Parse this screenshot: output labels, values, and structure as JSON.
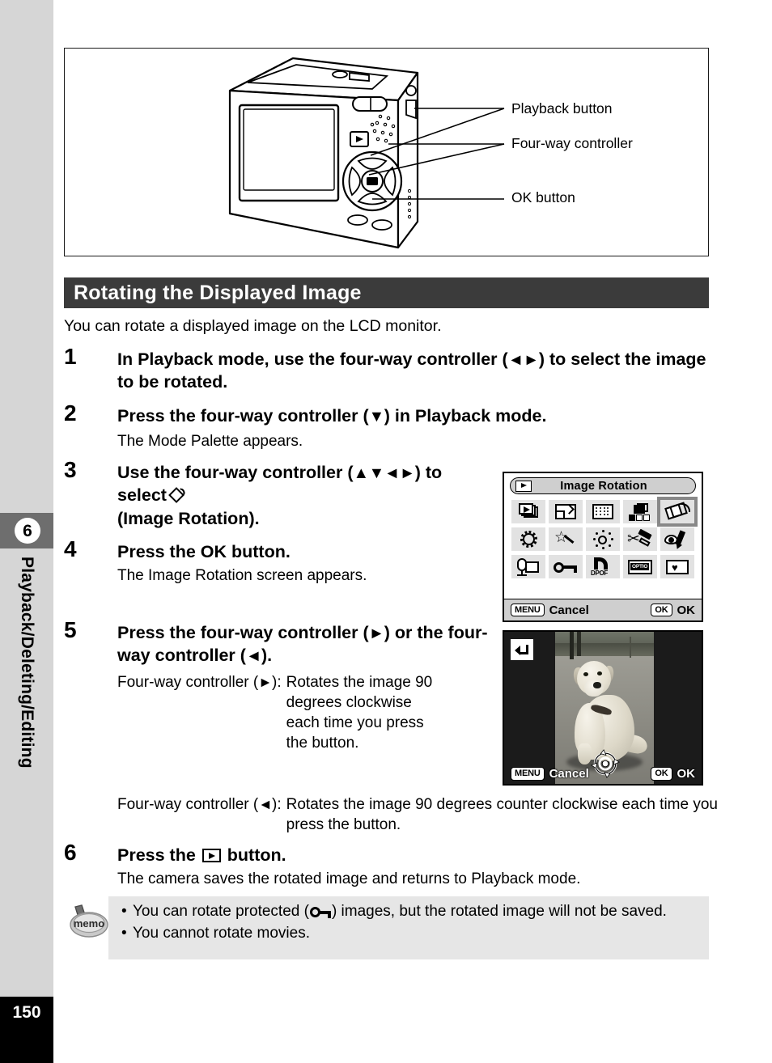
{
  "sidebar": {
    "chapter_number": "6",
    "chapter_label": "Playback/Deleting/Editing",
    "page_number": "150"
  },
  "figure": {
    "callouts": [
      {
        "label": "Playback button"
      },
      {
        "label": "Four-way controller"
      },
      {
        "label": "OK button"
      }
    ],
    "camera_parts": {
      "lcd_monitor": "lcd-monitor",
      "playback_button": "playback-button",
      "four_way_controller": "four-way-controller",
      "ok_button": "ok-button",
      "shutter_button": "shutter-button",
      "speaker": "speaker-holes"
    }
  },
  "section": {
    "heading": "Rotating the Displayed Image",
    "intro": "You can rotate a displayed image on the LCD monitor."
  },
  "steps": [
    {
      "number": "1",
      "title_pre": "In Playback mode, use the four-way controller (",
      "title_arrows": "◄►",
      "title_post": ") to select the image to be rotated.",
      "desc": ""
    },
    {
      "number": "2",
      "title_pre": "Press the four-way controller (",
      "title_arrows": "▼",
      "title_post": ") in Playback mode.",
      "desc": "The Mode Palette appears."
    },
    {
      "number": "3",
      "title_pre": "Use the four-way controller (",
      "title_arrows": "▲▼◄►",
      "title_post": ") to select",
      "title_tail": "(Image Rotation).",
      "desc": ""
    },
    {
      "number": "4",
      "title_pre": "Press the OK button.",
      "desc": "The Image Rotation screen appears."
    },
    {
      "number": "5",
      "title_pre": "Press the four-way controller (",
      "title_arrows": "►",
      "title_post": ") or the four-way controller (",
      "title_arrows2": "◄",
      "title_post2": ").",
      "desc": ""
    },
    {
      "number": "6",
      "title_pre": "Press the",
      "title_post": "button.",
      "desc": "The camera saves the rotated image and returns to Playback mode."
    }
  ],
  "definitions": [
    {
      "key_pre": "Four-way controller (",
      "key_arrow": "►",
      "key_post": "):",
      "value": "Rotates the image 90 degrees clockwise each time you press the button."
    },
    {
      "key_pre": "Four-way controller (",
      "key_arrow": "◄",
      "key_post": "):",
      "value": "Rotates the image 90 degrees counter clockwise each time you press the button."
    }
  ],
  "mode_palette_screen": {
    "title": "Image Rotation",
    "title_icon": "playback-icon",
    "selected_index": 4,
    "icons": [
      {
        "name": "slideshow-icon",
        "label": "Slideshow"
      },
      {
        "name": "resize-icon",
        "label": "Resize"
      },
      {
        "name": "nine-image-display-icon",
        "label": "Nine-image Display"
      },
      {
        "name": "image-copy-icon",
        "label": "Image/Sound Copy"
      },
      {
        "name": "image-rotation-icon",
        "label": "Image Rotation"
      },
      {
        "name": "frame-composite-icon",
        "label": "Frame Composite"
      },
      {
        "name": "digital-filter-icon",
        "label": "Digital Filter"
      },
      {
        "name": "brightness-filter-icon",
        "label": "Brightness Filter"
      },
      {
        "name": "trimming-icon",
        "label": "Trimming"
      },
      {
        "name": "red-eye-compensation-icon",
        "label": "Red-eye Compensation"
      },
      {
        "name": "voice-memo-icon",
        "label": "Voice Memo"
      },
      {
        "name": "protect-icon",
        "label": "Protect"
      },
      {
        "name": "dpof-icon",
        "label": "DPOF"
      },
      {
        "name": "start-up-screen-icon",
        "label": "Start-up Screen"
      },
      {
        "name": "favorite-icon",
        "label": "Favorite"
      }
    ],
    "footer": {
      "menu_key": "MENU",
      "menu_action": "Cancel",
      "ok_key": "OK",
      "ok_action": "OK"
    }
  },
  "photo_screen": {
    "subject": "golden-retriever-sitting-on-grass",
    "check_icon": "return-check-icon",
    "rotate_icon": "rotate-four-way-icon",
    "footer": {
      "menu_key": "MENU",
      "menu_action": "Cancel",
      "ok_key": "OK",
      "ok_action": "OK"
    }
  },
  "memo": {
    "icon_label": "memo",
    "items": [
      {
        "bullet": "•",
        "text_pre": "You can rotate protected (",
        "text_post": ") images, but the rotated image will not be saved."
      },
      {
        "bullet": "•",
        "text_pre": "You cannot rotate movies.",
        "text_post": ""
      }
    ]
  }
}
